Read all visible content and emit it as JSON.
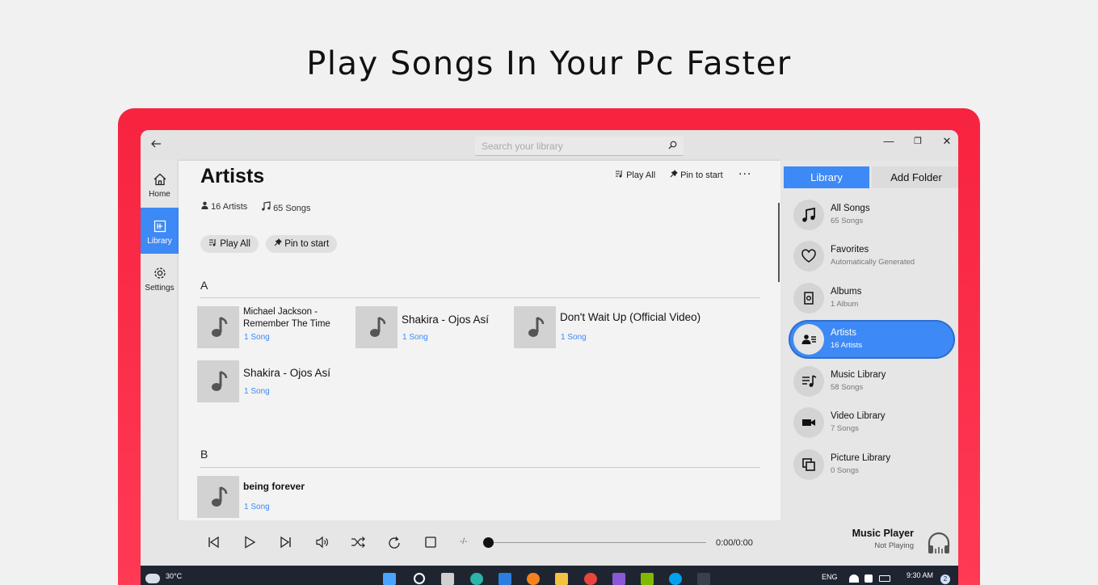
{
  "headline": "Play Songs In Your Pc Faster",
  "titlebar": {
    "search_placeholder": "Search your library",
    "minimize": "—",
    "maximize": "❐",
    "close": "✕"
  },
  "nav": {
    "items": [
      {
        "label": "Home",
        "icon": "home-icon",
        "active": false
      },
      {
        "label": "Library",
        "icon": "library-icon",
        "active": true
      },
      {
        "label": "Settings",
        "icon": "gear-icon",
        "active": false
      }
    ]
  },
  "main": {
    "title": "Artists",
    "actions": {
      "play_all": "Play All",
      "pin_to_start": "Pin to start",
      "more": "..."
    },
    "stats": {
      "artists": "16 Artists",
      "songs": "65 Songs"
    },
    "pills": {
      "play_all": "Play All",
      "pin_to_start": "Pin to start"
    },
    "sections": [
      {
        "letter": "A",
        "artists": [
          {
            "name": "Michael Jackson - Remember The Time",
            "count": "1 Song"
          },
          {
            "name": "Shakira - Ojos Así",
            "count": "1 Song"
          },
          {
            "name": "Don't Wait Up (Official Video)",
            "count": "1 Song"
          },
          {
            "name": "Shakira - Ojos Así",
            "count": "1 Song"
          }
        ]
      },
      {
        "letter": "B",
        "artists": [
          {
            "name": "being forever",
            "count": "1 Song"
          }
        ]
      }
    ]
  },
  "right_panel": {
    "library_button": "Library",
    "add_folder_button": "Add Folder",
    "items": [
      {
        "title": "All Songs",
        "sub": "65 Songs",
        "icon": "music-notes-icon",
        "active": false
      },
      {
        "title": "Favorites",
        "sub": "Automatically Generated",
        "icon": "heart-icon",
        "active": false
      },
      {
        "title": "Albums",
        "sub": "1 Album",
        "icon": "album-icon",
        "active": false
      },
      {
        "title": "Artists",
        "sub": "16 Artists",
        "icon": "artist-icon",
        "active": true
      },
      {
        "title": "Music Library",
        "sub": "58 Songs",
        "icon": "playlist-icon",
        "active": false
      },
      {
        "title": "Video Library",
        "sub": "7 Songs",
        "icon": "video-camera-icon",
        "active": false
      },
      {
        "title": "Picture Library",
        "sub": "0 Songs",
        "icon": "picture-icon",
        "active": false
      }
    ]
  },
  "player": {
    "speed": "-/-",
    "time": "0:00/0:00",
    "progress": 0,
    "title": "Music Player",
    "status": "Not Playing"
  },
  "taskbar": {
    "temperature": "30°C",
    "language": "ENG",
    "time": "9:30 AM",
    "notification_count": "2"
  },
  "colors": {
    "accent": "#3d89f5",
    "frame": "#f7233f",
    "taskbar": "#1f2530"
  }
}
